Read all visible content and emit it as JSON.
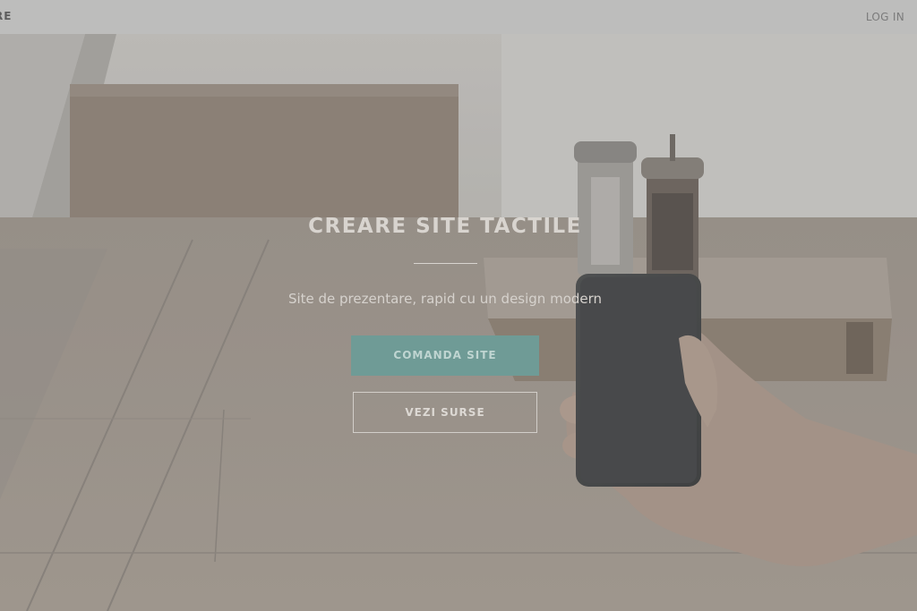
{
  "header": {
    "brand": "RE",
    "login_label": "LOG IN"
  },
  "hero": {
    "title": "CREARE SITE TACTILE",
    "subtitle": "Site de prezentare, rapid cu un design modern",
    "primary_button": "COMANDA SITE",
    "secondary_button": "VEZI SURSE"
  },
  "colors": {
    "topbar": "#bdbdbc",
    "accent": "#6f9b96",
    "hero_text": "#d8d4cf"
  }
}
